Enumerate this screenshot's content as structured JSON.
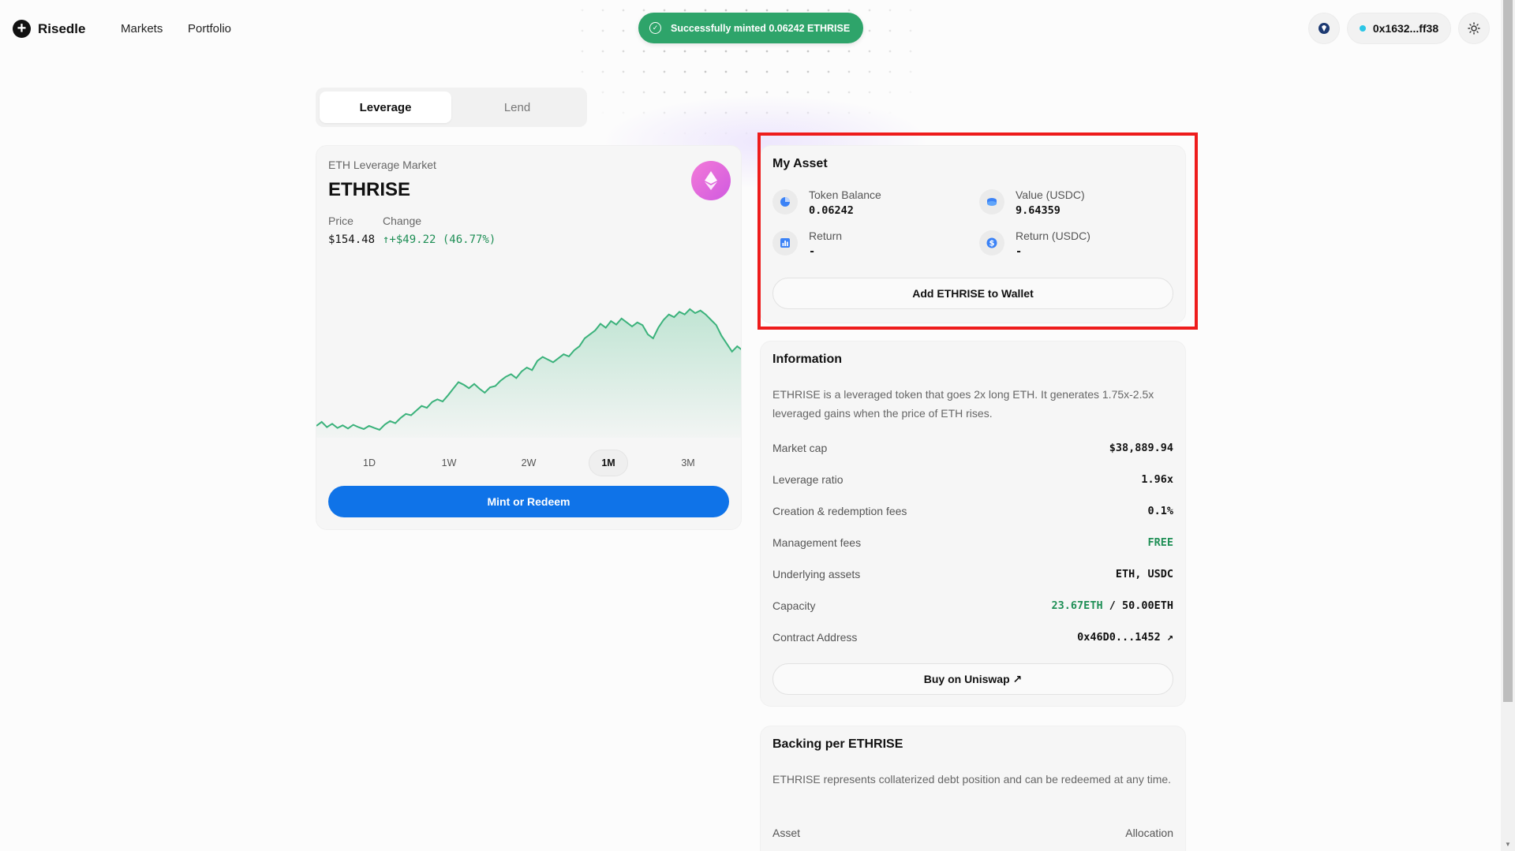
{
  "nav": {
    "brand": "Risedle",
    "links": [
      "Markets",
      "Portfolio"
    ],
    "toast": "Successfully minted 0.06242 ETHRISE",
    "wallet": "0x1632...ff38"
  },
  "tabs": [
    "Leverage",
    "Lend"
  ],
  "market": {
    "subtitle": "ETH Leverage Market",
    "title": "ETHRISE",
    "price_label": "Price",
    "change_label": "Change",
    "price": "$154.48",
    "change": "↑+$49.22 (46.77%)",
    "periods": [
      "1D",
      "1W",
      "2W",
      "1M",
      "3M"
    ],
    "active_period": "1M",
    "mint_button": "Mint or Redeem"
  },
  "my_asset": {
    "title": "My Asset",
    "token_balance_label": "Token Balance",
    "token_balance": "0.06242",
    "value_label": "Value (USDC)",
    "value": "9.64359",
    "return_label": "Return",
    "return": "-",
    "return_usdc_label": "Return (USDC)",
    "return_usdc": "-",
    "add_button": "Add ETHRISE to Wallet"
  },
  "information": {
    "title": "Information",
    "description": "ETHRISE is a leveraged token that goes 2x long ETH. It generates 1.75x-2.5x leveraged gains when the price of ETH rises.",
    "rows": [
      {
        "label": "Market cap",
        "value": "$38,889.94"
      },
      {
        "label": "Leverage ratio",
        "value": "1.96x"
      },
      {
        "label": "Creation & redemption fees",
        "value": "0.1%"
      },
      {
        "label": "Management fees",
        "value": "FREE"
      },
      {
        "label": "Underlying assets",
        "value": "ETH, USDC"
      },
      {
        "label": "Capacity",
        "value_used": "23.67ETH",
        "value_sep": " / ",
        "value_total": "50.00ETH"
      },
      {
        "label": "Contract Address",
        "value": "0x46D0...1452 ↗"
      }
    ],
    "uniswap_button": "Buy on Uniswap ↗"
  },
  "backing": {
    "title": "Backing per ETHRISE",
    "description": "ETHRISE represents collaterized debt position and can be redeemed at any time.",
    "col_asset": "Asset",
    "col_allocation": "Allocation"
  },
  "colors": {
    "toast_green": "#2ea46a",
    "accent_blue": "#0f73e8",
    "positive_green": "#1f8f56",
    "highlight_red": "#ee1c1c"
  },
  "chart_data": {
    "type": "area",
    "series": [
      {
        "values": [
          2.0,
          3.5,
          1.5,
          2.8,
          1.2,
          2.2,
          1.0,
          2.4,
          1.5,
          0.8,
          2.0,
          1.2,
          0.5,
          2.5,
          3.8,
          3.0,
          5.0,
          6.5,
          6.0,
          7.8,
          9.5,
          8.8,
          11.0,
          12.0,
          11.2,
          13.5,
          16.0,
          18.5,
          17.5,
          16.2,
          17.8,
          16.0,
          14.5,
          16.5,
          17.0,
          19.0,
          20.5,
          21.5,
          20.0,
          22.5,
          24.0,
          23.0,
          26.5,
          28.0,
          27.0,
          26.0,
          27.5,
          29.0,
          28.2,
          30.5,
          32.0,
          35.0,
          36.5,
          38.0,
          40.5,
          39.0,
          41.5,
          40.2,
          42.5,
          41.0,
          39.5,
          41.0,
          40.0,
          36.5,
          35.0,
          39.0,
          42.0,
          44.0,
          43.0,
          45.0,
          44.0,
          46.0,
          44.5,
          45.5,
          44.0,
          42.0,
          40.0,
          36.0,
          33.0,
          30.0,
          32.0,
          30.5
        ]
      }
    ]
  }
}
